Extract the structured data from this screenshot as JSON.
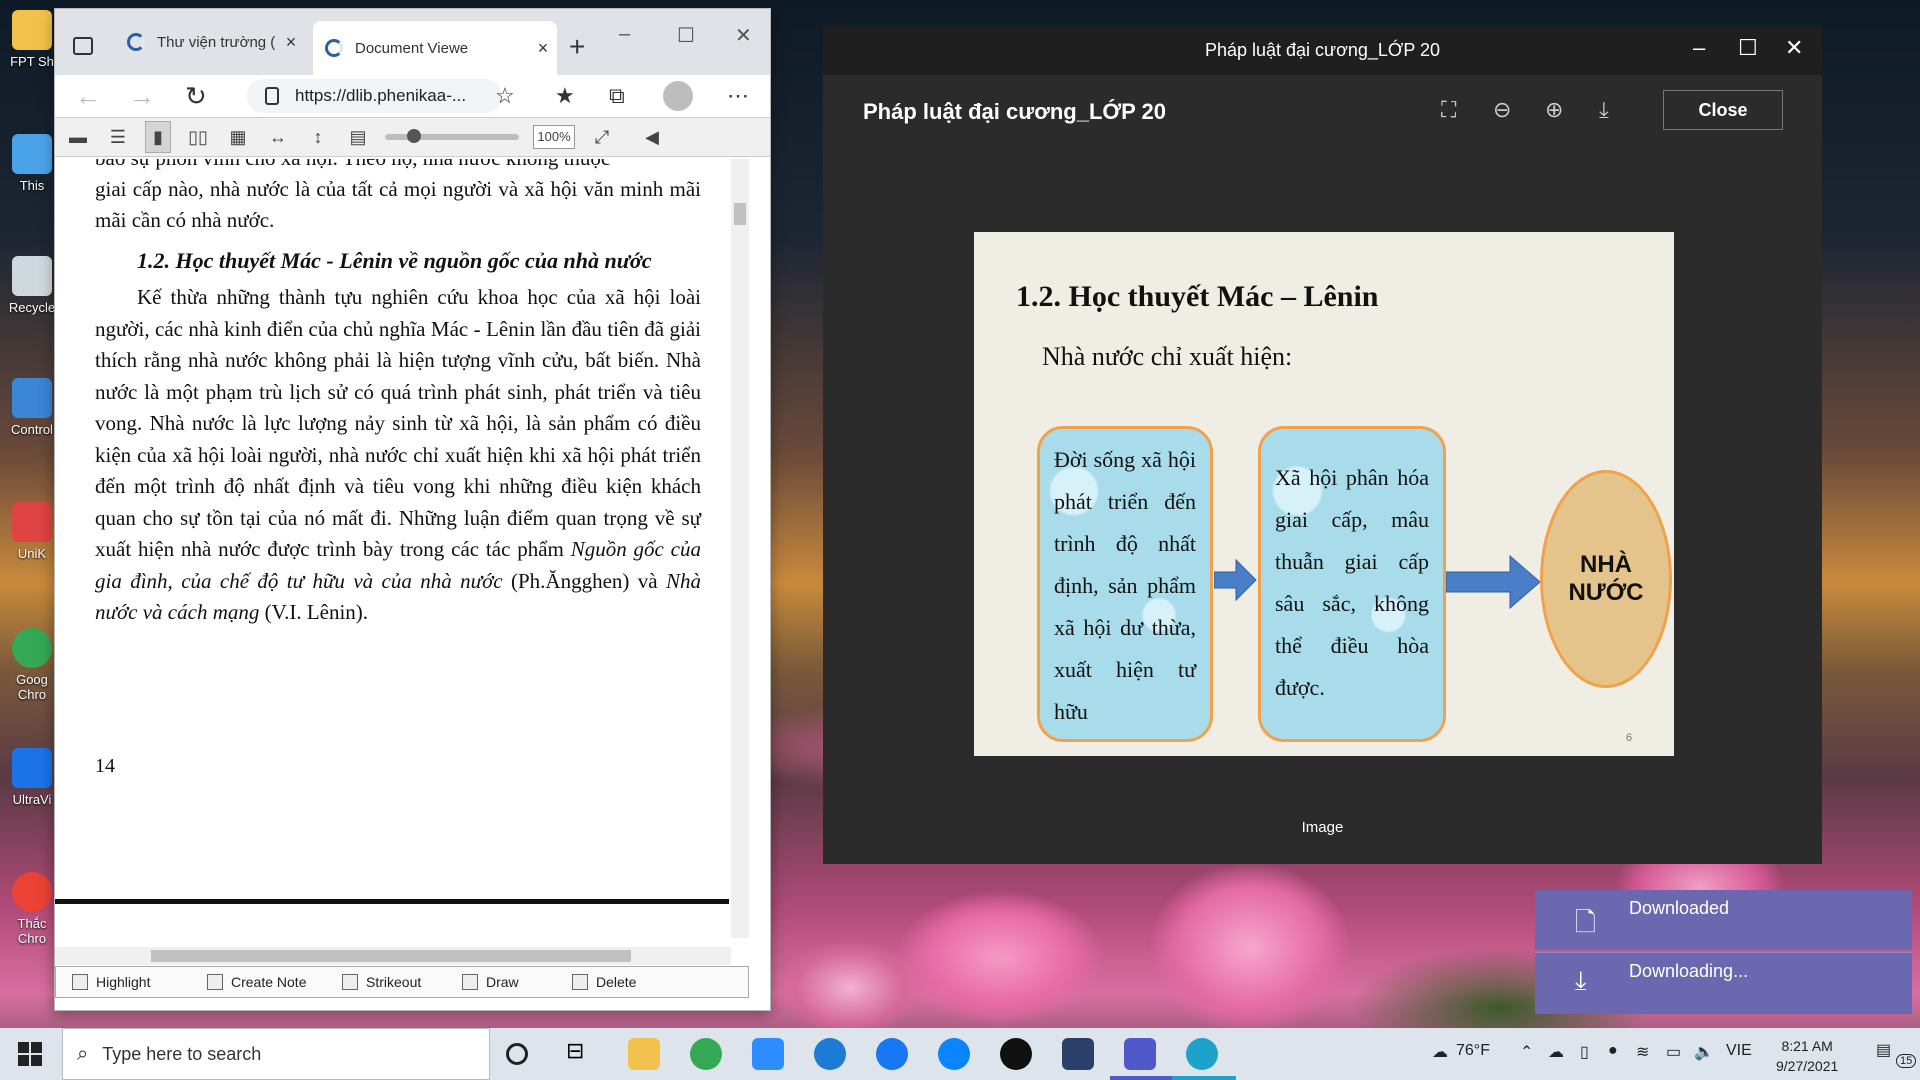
{
  "desktop": {
    "icons": [
      {
        "label": "FPT Sh",
        "color": "#f0c24a"
      },
      {
        "label": "This",
        "color": "#4aa3e8"
      },
      {
        "label": "Recycle",
        "color": "#cfd8dc"
      },
      {
        "label": "Control",
        "color": "#3b86d6"
      },
      {
        "label": "UniK",
        "color": "#e04343"
      },
      {
        "label": "Goog Chro",
        "color": "#34a853"
      },
      {
        "label": "UltraVi",
        "color": "#1a73e8"
      },
      {
        "label": "Thắc Chro",
        "color": "#ea4335"
      }
    ]
  },
  "browser": {
    "tabs": [
      {
        "label": "Thư viện trường ("
      },
      {
        "label": "Document Viewe"
      }
    ],
    "url": "https://dlib.phenikaa-...",
    "zoom": "100%",
    "document": {
      "top_line": "bảo sự phồn vinh cho xã hội. Theo họ, nhà nước không thuộc",
      "para1": "giai cấp nào, nhà nước là của tất cả mọi người và xã hội văn minh mãi mãi cần có nhà nước.",
      "heading": "1.2. Học thuyết Mác - Lênin về nguồn gốc của nhà nước",
      "para2_a": "Kế thừa những thành tựu nghiên cứu khoa học của xã hội loài người, các nhà kinh điển của chủ nghĩa Mác - Lênin lần đầu tiên đã giải thích rằng nhà nước không phải là hiện tượng vĩnh cửu, bất biến. Nhà nước là một phạm trù lịch sử có quá trình phát sinh, phát triển và tiêu vong. Nhà nước là lực lượng nảy sinh từ xã hội, là sản phẩm có điều kiện của xã hội loài người, nhà nước chỉ xuất hiện khi xã hội phát triển đến một trình độ nhất định và tiêu vong khi những điều kiện khách quan cho sự tồn tại của nó mất đi. Những luận điểm quan trọng về sự xuất hiện nhà nước được trình bày trong các tác phẩm ",
      "para2_i1": "Nguồn gốc của gia đình, của chế độ tư hữu và của nhà nước",
      "para2_b": " (Ph.Ăngghen) và ",
      "para2_i2": "Nhà nước và cách mạng",
      "para2_c": " (V.I. Lênin).",
      "page_number": "14"
    },
    "annotation_tools": [
      "Highlight",
      "Create Note",
      "Strikeout",
      "Draw",
      "Delete"
    ]
  },
  "viewer": {
    "window_title": "Pháp luật đại cương_LỚP 20",
    "header_title": "Pháp luật đại cương_LỚP 20",
    "close_label": "Close",
    "caption": "Image",
    "slide": {
      "title": "1.2. Học thuyết Mác – Lênin",
      "subtitle": "Nhà nước chỉ xuất hiện:",
      "box1": "Đời sống xã hội phát triển đến trình độ nhất định, sản phẩm xã hội dư thừa, xuất hiện tư hữu",
      "box2": "Xã hội phân hóa giai cấp, mâu thuẫn giai cấp sâu sắc, không thể điều hòa được.",
      "oval": "NHÀ NƯỚC",
      "slide_number": "6"
    }
  },
  "notifications": [
    {
      "label": "Downloaded"
    },
    {
      "label": "Downloading..."
    }
  ],
  "taskbar": {
    "search_placeholder": "Type here to search",
    "weather": "76°F",
    "language": "VIE",
    "time": "8:21 AM",
    "date": "9/27/2021",
    "notification_count": "15"
  }
}
